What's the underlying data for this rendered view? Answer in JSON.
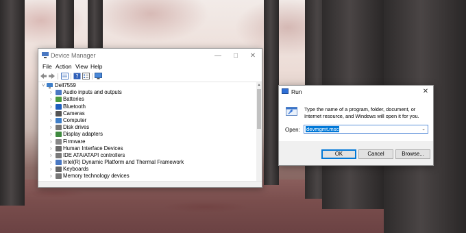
{
  "device_manager": {
    "title": "Device Manager",
    "menu": [
      "File",
      "Action",
      "View",
      "Help"
    ],
    "toolbar_icons": [
      "back-arrow-icon",
      "forward-arrow-icon",
      "properties-icon",
      "help-icon",
      "device-list-icon",
      "monitor-scan-icon"
    ],
    "root": "Dell7559",
    "categories": [
      {
        "label": "Audio inputs and outputs",
        "icon": "speaker-icon",
        "color": "#4a78c2"
      },
      {
        "label": "Batteries",
        "icon": "battery-icon",
        "color": "#4c9a3f"
      },
      {
        "label": "Bluetooth",
        "icon": "bluetooth-icon",
        "color": "#1f5fbf"
      },
      {
        "label": "Cameras",
        "icon": "camera-icon",
        "color": "#555555"
      },
      {
        "label": "Computer",
        "icon": "computer-icon",
        "color": "#3f7fc9"
      },
      {
        "label": "Disk drives",
        "icon": "disk-drive-icon",
        "color": "#777777"
      },
      {
        "label": "Display adapters",
        "icon": "display-adapter-icon",
        "color": "#3f8a3f"
      },
      {
        "label": "Firmware",
        "icon": "firmware-icon",
        "color": "#888888"
      },
      {
        "label": "Human Interface Devices",
        "icon": "hid-icon",
        "color": "#6a6a6a"
      },
      {
        "label": "IDE ATA/ATAPI controllers",
        "icon": "ide-controller-icon",
        "color": "#7a7a7a"
      },
      {
        "label": "Intel(R) Dynamic Platform and Thermal Framework",
        "icon": "thermal-framework-icon",
        "color": "#4a78c2"
      },
      {
        "label": "Keyboards",
        "icon": "keyboard-icon",
        "color": "#666666"
      },
      {
        "label": "Memory technology devices",
        "icon": "memory-device-icon",
        "color": "#777777"
      }
    ]
  },
  "run_dialog": {
    "title": "Run",
    "description": "Type the name of a program, folder, document, or Internet resource, and Windows will open it for you.",
    "open_label": "Open:",
    "open_value": "devmgmt.msc",
    "buttons": {
      "ok": "OK",
      "cancel": "Cancel",
      "browse": "Browse..."
    }
  }
}
